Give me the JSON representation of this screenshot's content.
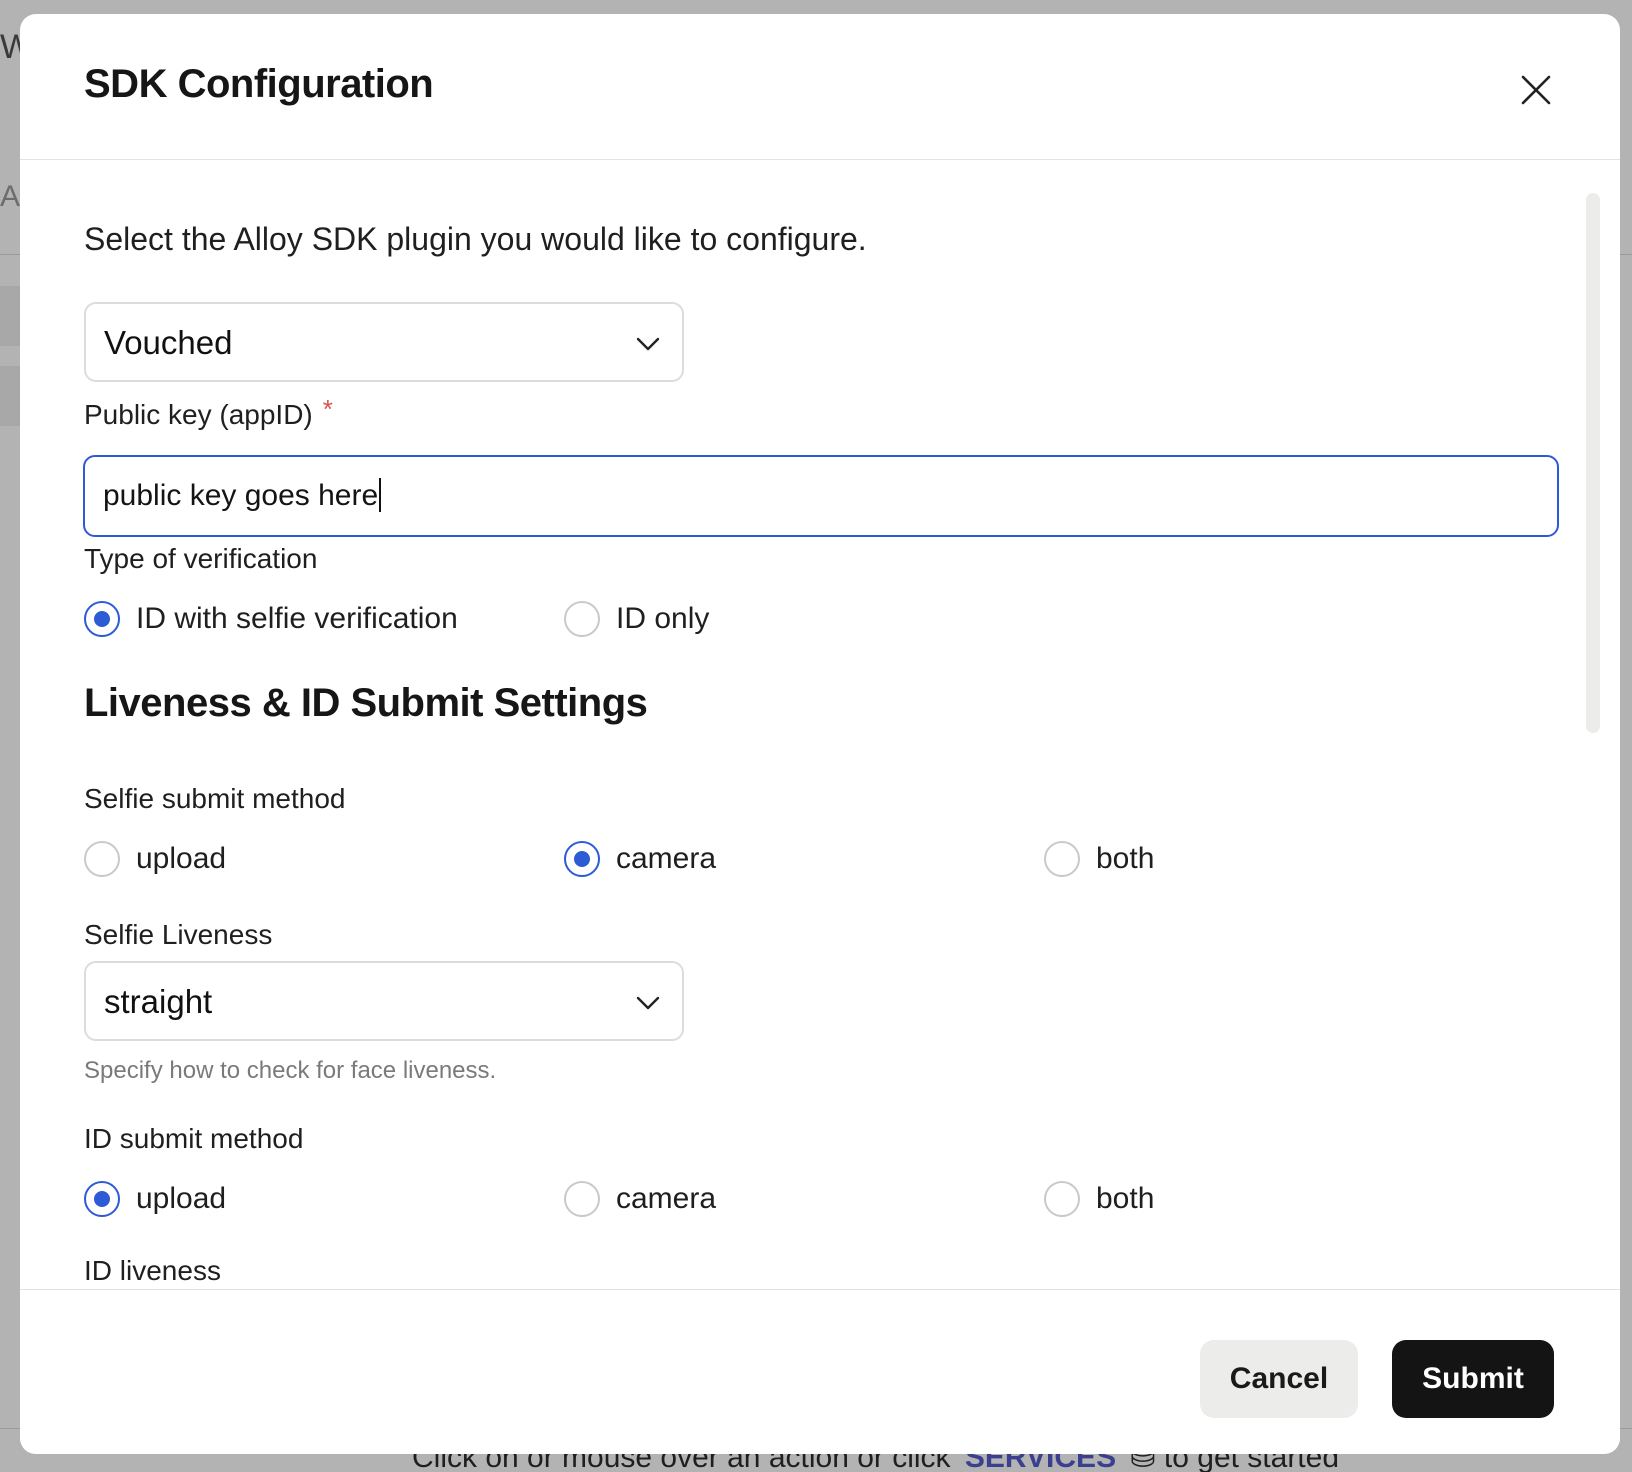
{
  "background": {
    "edge_text_1": "W",
    "edge_text_2": "AM",
    "footer_prefix": "Click on or mouse over an action or click",
    "footer_link": "SERVICES",
    "footer_suffix": "to get started"
  },
  "modal": {
    "title": "SDK Configuration",
    "intro": "Select the Alloy SDK plugin you would like to configure.",
    "plugin_select": {
      "value": "Vouched"
    },
    "public_key": {
      "label": "Public key (appID)",
      "required_mark": "*",
      "value": "public key goes here"
    },
    "verification": {
      "label": "Type of verification",
      "options": [
        {
          "label": "ID with selfie verification",
          "selected": true
        },
        {
          "label": "ID only",
          "selected": false
        }
      ]
    },
    "section_title": "Liveness & ID Submit Settings",
    "selfie_submit": {
      "label": "Selfie submit method",
      "options": [
        {
          "label": "upload",
          "selected": false
        },
        {
          "label": "camera",
          "selected": true
        },
        {
          "label": "both",
          "selected": false
        }
      ]
    },
    "selfie_liveness": {
      "label": "Selfie Liveness",
      "value": "straight",
      "help": "Specify how to check for face liveness."
    },
    "id_submit": {
      "label": "ID submit method",
      "options": [
        {
          "label": "upload",
          "selected": true
        },
        {
          "label": "camera",
          "selected": false
        },
        {
          "label": "both",
          "selected": false
        }
      ]
    },
    "id_liveness": {
      "label": "ID liveness"
    },
    "footer": {
      "cancel_label": "Cancel",
      "submit_label": "Submit"
    }
  },
  "colors": {
    "accent": "#2d5bd6",
    "required": "#d9534f",
    "submit_bg": "#141414",
    "cancel_bg": "#ececea"
  }
}
